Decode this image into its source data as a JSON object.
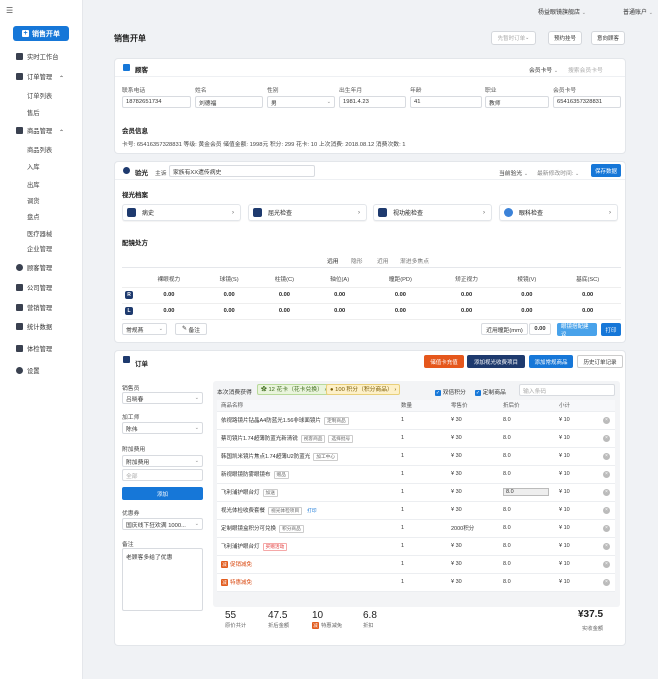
{
  "sidebar": {
    "menu_glyph": "☰",
    "sale_button": "销售开单",
    "items": [
      {
        "label": "实时工作台",
        "icon": "dashboard-icon",
        "sub": false,
        "arrow": ""
      },
      {
        "label": "订单管理",
        "icon": "order-icon",
        "sub": false,
        "arrow": "^"
      },
      {
        "label": "订单列表",
        "sub": true
      },
      {
        "label": "售后",
        "sub": true
      },
      {
        "label": "商品管理",
        "icon": "goods-icon",
        "sub": false,
        "arrow": "^"
      },
      {
        "label": "商品列表",
        "sub": true
      },
      {
        "label": "入库",
        "sub": true
      },
      {
        "label": "出库",
        "sub": true
      },
      {
        "label": "调货",
        "sub": true
      },
      {
        "label": "盘点",
        "sub": true
      },
      {
        "label": "医疗器械",
        "sub": true
      },
      {
        "label": "企业管理",
        "sub": true
      },
      {
        "label": "顾客管理",
        "icon": "customer-icon",
        "sub": false,
        "arrow": ""
      },
      {
        "label": "公司管理",
        "icon": "company-icon",
        "sub": false,
        "arrow": ""
      },
      {
        "label": "营销管理",
        "icon": "marketing-icon",
        "sub": false,
        "arrow": ""
      },
      {
        "label": "统计数据",
        "icon": "stats-icon",
        "sub": false,
        "arrow": ""
      },
      {
        "label": "体检管理",
        "icon": "checkup-icon",
        "sub": false,
        "arrow": ""
      },
      {
        "label": "设置",
        "icon": "settings-icon",
        "sub": false,
        "arrow": ""
      }
    ]
  },
  "topbar": {
    "store": "杨益眼镜旗舰店",
    "account": "普通账户"
  },
  "page": {
    "title": "销售开单",
    "btn_pending": "先暂时订单",
    "btn_appointment": "预约挂号",
    "btn_intent": "意向顾客"
  },
  "customer": {
    "title": "顾客",
    "search_type": "会员卡号",
    "search_placeholder": "搜索会员卡号",
    "fields": [
      {
        "label": "联系电话",
        "value": "18782651734"
      },
      {
        "label": "姓名",
        "value": "刘德福"
      },
      {
        "label": "性别",
        "value": "男"
      },
      {
        "label": "出生年月",
        "value": "1981.4.23"
      },
      {
        "label": "年龄",
        "value": "41"
      },
      {
        "label": "职业",
        "value": "教师"
      },
      {
        "label": "会员卡号",
        "value": "65416357328831"
      }
    ],
    "member_title": "会员信息",
    "member_line": "卡号: 65416357328831    等级: 黄金会员    储值金额: 1998元    积分: 299    花卡: 10    上次消费: 2018.08.12    消费次数: 1"
  },
  "optometry": {
    "title": "验光",
    "complaint_label": "主诉",
    "complaint": "家族有XX遗传病史",
    "current_label": "当前验光",
    "latest_label": "最新修改时间:",
    "save": "保存数据",
    "archive_title": "视光档案",
    "exams": [
      "病史",
      "屈光检查",
      "视功能检查",
      "眼科检查"
    ],
    "rx_title": "配镜处方",
    "rx_tabs": [
      "远用",
      "隐形",
      "近用",
      "渐进多焦点"
    ],
    "rx_headers": [
      "",
      "裸眼视力",
      "球镜(S)",
      "柱镜(C)",
      "轴位(A)",
      "瞳距(PD)",
      "矫正视力",
      "棱镜(V)",
      "基底(SC)"
    ],
    "rx_rows": [
      {
        "eye": "R",
        "values": [
          "0.00",
          "0.00",
          "0.00",
          "0.00",
          "0.00",
          "0.00",
          "0.00",
          "0.00"
        ]
      },
      {
        "eye": "L",
        "values": [
          "0.00",
          "0.00",
          "0.00",
          "0.00",
          "0.00",
          "0.00",
          "0.00",
          "0.00"
        ]
      }
    ],
    "lens_type": "常规燕",
    "remark_btn": "备注",
    "pd_label": "近用瞳距(mm)",
    "pd_value": "0.00",
    "suggest": "眼镜搭配建议",
    "print": "打印"
  },
  "order": {
    "title": "订单",
    "btn_recharge": "储值卡充值",
    "btn_add_vision": "添加视光收费项目",
    "btn_add_normal": "添加常规商品",
    "btn_history": "历史订单记录",
    "salesperson_label": "销售员",
    "salesperson": "吕晓春",
    "processor_label": "加工师",
    "processor": "陈伟",
    "extra_label": "附加费用",
    "extra": "附加费用",
    "extra_all": "全部",
    "add_btn": "添加",
    "coupon_label": "优惠券",
    "coupon": "国庆线下狂欢满 1000...",
    "note_label": "备注",
    "note": "老顾客多给了优惠",
    "earn_label": "本次消费获得",
    "earn1": "12 花卡（花卡兑换）",
    "earn2": "100 积分（积分商品）",
    "chk_points": "双倍积分",
    "chk_custom": "定制商品",
    "barcode_ph": "输入条码",
    "headers": [
      "商品名称",
      "数量",
      "零售价",
      "折后价",
      "小计",
      ""
    ],
    "rows": [
      {
        "name": "依视路镜片钻晶A4防蓝光1.56非球面镜片",
        "tag": "定制商品",
        "qty": "1",
        "price": "¥ 30",
        "disc": "8.0",
        "sub": "¥ 10",
        "type": ""
      },
      {
        "name": "蔡司镜片1.74超薄防蓝光新清锐",
        "tag": "视客商品",
        "tag2": "选择批号",
        "qty": "1",
        "price": "¥ 30",
        "disc": "8.0",
        "sub": "¥ 10",
        "type": ""
      },
      {
        "name": "韩国凯米镜片焦点1.74超薄U2防蓝光",
        "tag": "加工中心",
        "qty": "1",
        "price": "¥ 30",
        "disc": "8.0",
        "sub": "¥ 10",
        "type": ""
      },
      {
        "name": "新视眼镜防雾眼镜布",
        "tag": "赠品",
        "qty": "1",
        "price": "¥ 30",
        "disc": "8.0",
        "sub": "¥ 10",
        "type": ""
      },
      {
        "name": "飞利浦护眼台灯",
        "tag": "加送",
        "qty": "1",
        "price": "¥ 30",
        "disc": "8.0",
        "sub": "¥ 10",
        "type": "editing"
      },
      {
        "name": "视光体检收费套餐",
        "tag": "视光体检项目",
        "tag2": "打印",
        "qty": "1",
        "price": "¥ 30",
        "disc": "8.0",
        "sub": "¥ 10",
        "type": ""
      },
      {
        "name": "定制眼镜盒积分可兑换",
        "tag": "积分商品",
        "qty": "1",
        "price": "2000积分",
        "disc": "8.0",
        "sub": "¥ 10",
        "type": ""
      },
      {
        "name": "飞利浦护眼台灯",
        "tag": "买赠活动",
        "qty": "1",
        "price": "¥ 30",
        "disc": "8.0",
        "sub": "¥ 10",
        "type": "promo"
      },
      {
        "name": "促销减免",
        "tag": "",
        "qty": "1",
        "price": "¥ 30",
        "disc": "8.0",
        "sub": "¥ 10",
        "type": "discount"
      },
      {
        "name": "特惠减免",
        "tag": "",
        "qty": "1",
        "price": "¥ 30",
        "disc": "8.0",
        "sub": "¥ 10",
        "type": "discount"
      }
    ],
    "summary": [
      {
        "n": "55",
        "l": "原价共计"
      },
      {
        "n": "47.5",
        "l": "折后金额"
      },
      {
        "n": "10",
        "l": "特惠减免"
      },
      {
        "n": "6.8",
        "l": "折扣"
      }
    ],
    "total": "¥37.5",
    "total_label": "实收金额"
  }
}
